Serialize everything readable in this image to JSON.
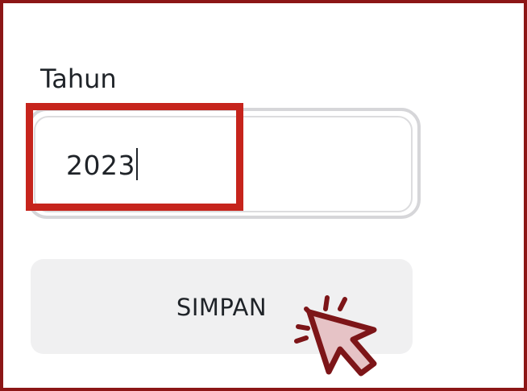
{
  "form": {
    "year_label": "Tahun",
    "year_value": "2023",
    "save_label": "SIMPAN"
  },
  "icons": {
    "pointer": "cursor-click-icon"
  },
  "colors": {
    "frame_border": "#8c1616",
    "highlight": "#c6241c",
    "cursor_fill": "#e6c3c6",
    "cursor_stroke": "#7d1518",
    "button_bg": "#f0f0f1"
  }
}
